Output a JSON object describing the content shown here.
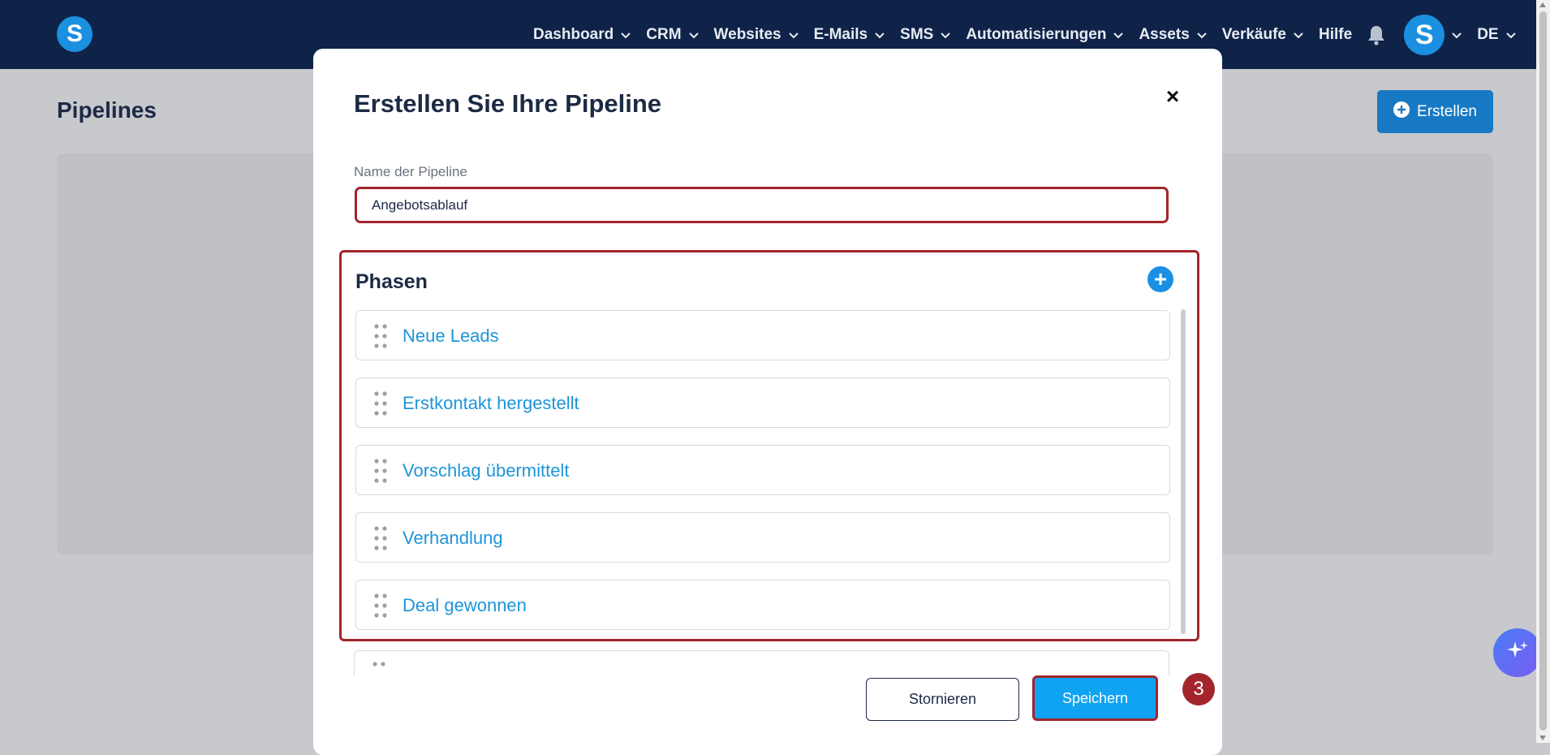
{
  "nav": {
    "logo_letter": "S",
    "items": [
      {
        "label": "Dashboard",
        "has_dropdown": true
      },
      {
        "label": "CRM",
        "has_dropdown": true
      },
      {
        "label": "Websites",
        "has_dropdown": true
      },
      {
        "label": "E-Mails",
        "has_dropdown": true
      },
      {
        "label": "SMS",
        "has_dropdown": true
      },
      {
        "label": "Automatisierungen",
        "has_dropdown": true
      },
      {
        "label": "Assets",
        "has_dropdown": true
      },
      {
        "label": "Verkäufe",
        "has_dropdown": true
      },
      {
        "label": "Hilfe",
        "has_dropdown": false
      }
    ],
    "avatar_letter": "S",
    "language": "DE",
    "bell_icon": "bell-icon"
  },
  "page": {
    "title": "Pipelines",
    "create_label": "Erstellen"
  },
  "modal": {
    "title": "Erstellen Sie Ihre Pipeline",
    "close_symbol": "×",
    "name_label": "Name der Pipeline",
    "name_value": "Angebotsablauf",
    "phases_title": "Phasen",
    "add_symbol": "+",
    "phases": [
      "Neue Leads",
      "Erstkontakt hergestellt",
      "Vorschlag übermittelt",
      "Verhandlung",
      "Deal gewonnen"
    ],
    "cancel_label": "Stornieren",
    "save_label": "Speichern"
  },
  "annotation": {
    "step_number": "3",
    "highlight_color": "#a3252c"
  },
  "colors": {
    "nav_bg": "#0f2348",
    "accent": "#1d95d8",
    "primary_button": "#10a3f2"
  }
}
